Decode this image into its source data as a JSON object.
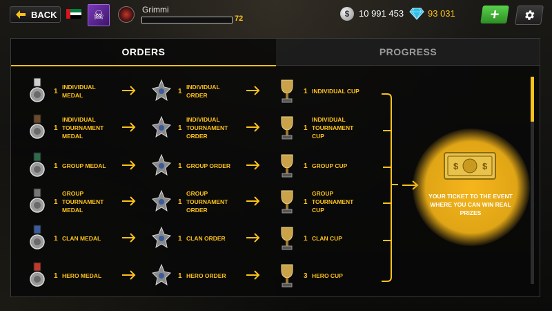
{
  "header": {
    "back_label": "BACK",
    "player_name": "Grimmi",
    "level": "72",
    "xp_fraction": 0.0,
    "silver": "10 991 453",
    "gems": "93 031"
  },
  "tabs": [
    {
      "label": "ORDERS",
      "active": true
    },
    {
      "label": "PROGRESS",
      "active": false
    }
  ],
  "rows": [
    {
      "medal": {
        "qty": "1",
        "name": "INDIVIDUAL\nMEDAL"
      },
      "order": {
        "qty": "1",
        "name": "INDIVIDUAL\nORDER"
      },
      "cup": {
        "qty": "1",
        "name": "INDIVIDUAL CUP"
      }
    },
    {
      "medal": {
        "qty": "1",
        "name": "INDIVIDUAL\nTOURNAMENT\nMEDAL"
      },
      "order": {
        "qty": "1",
        "name": "INDIVIDUAL\nTOURNAMENT\nORDER"
      },
      "cup": {
        "qty": "1",
        "name": "INDIVIDUAL\nTOURNAMENT\nCUP"
      }
    },
    {
      "medal": {
        "qty": "1",
        "name": "GROUP MEDAL"
      },
      "order": {
        "qty": "1",
        "name": "GROUP ORDER"
      },
      "cup": {
        "qty": "1",
        "name": "GROUP CUP"
      }
    },
    {
      "medal": {
        "qty": "1",
        "name": "GROUP\nTOURNAMENT\nMEDAL"
      },
      "order": {
        "qty": "1",
        "name": "GROUP\nTOURNAMENT\nORDER"
      },
      "cup": {
        "qty": "1",
        "name": "GROUP\nTOURNAMENT\nCUP"
      }
    },
    {
      "medal": {
        "qty": "1",
        "name": "CLAN MEDAL"
      },
      "order": {
        "qty": "1",
        "name": "CLAN ORDER"
      },
      "cup": {
        "qty": "1",
        "name": "CLAN CUP"
      }
    },
    {
      "medal": {
        "qty": "1",
        "name": "HERO MEDAL"
      },
      "order": {
        "qty": "1",
        "name": "HERO ORDER"
      },
      "cup": {
        "qty": "3",
        "name": "HERO CUP"
      }
    }
  ],
  "reward": {
    "text": "YOUR TICKET TO THE EVENT WHERE YOU CAN WIN REAL PRIZES"
  },
  "colors": {
    "accent": "#fcc21b",
    "green_button": "#3fb133"
  }
}
